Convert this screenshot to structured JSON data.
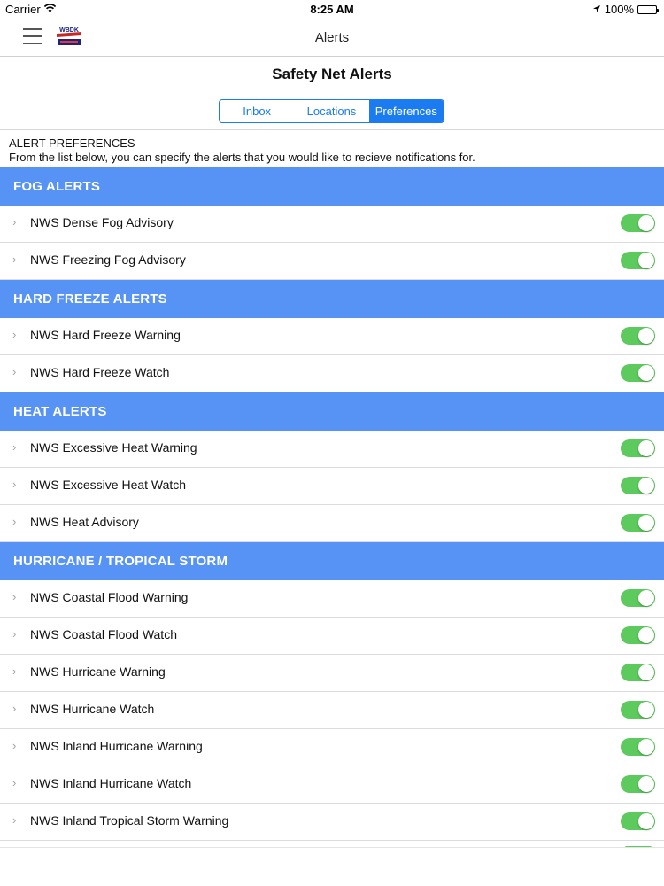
{
  "status_bar": {
    "carrier": "Carrier",
    "time": "8:25 AM",
    "battery": "100%"
  },
  "nav": {
    "title": "Alerts",
    "logo_text": "WBDK"
  },
  "page": {
    "title": "Safety Net Alerts",
    "segments": [
      {
        "label": "Inbox",
        "active": false
      },
      {
        "label": "Locations",
        "active": false
      },
      {
        "label": "Preferences",
        "active": true
      }
    ],
    "prefs_heading": "ALERT PREFERENCES",
    "prefs_description": "From the list below, you can specify the alerts that you would like to recieve notifications for."
  },
  "colors": {
    "accent": "#1b7cf2",
    "section_header": "#5792f5",
    "toggle_on": "#5cca5c"
  },
  "sections": [
    {
      "title": "FOG ALERTS",
      "items": [
        {
          "label": "NWS Dense Fog Advisory",
          "enabled": true
        },
        {
          "label": "NWS Freezing Fog Advisory",
          "enabled": true
        }
      ]
    },
    {
      "title": "HARD FREEZE ALERTS",
      "items": [
        {
          "label": "NWS Hard Freeze Warning",
          "enabled": true
        },
        {
          "label": "NWS Hard Freeze Watch",
          "enabled": true
        }
      ]
    },
    {
      "title": "HEAT ALERTS",
      "items": [
        {
          "label": "NWS Excessive Heat Warning",
          "enabled": true
        },
        {
          "label": "NWS Excessive Heat Watch",
          "enabled": true
        },
        {
          "label": "NWS Heat Advisory",
          "enabled": true
        }
      ]
    },
    {
      "title": "HURRICANE / TROPICAL STORM",
      "items": [
        {
          "label": "NWS Coastal Flood Warning",
          "enabled": true
        },
        {
          "label": "NWS Coastal Flood Watch",
          "enabled": true
        },
        {
          "label": "NWS Hurricane Warning",
          "enabled": true
        },
        {
          "label": "NWS Hurricane Watch",
          "enabled": true
        },
        {
          "label": "NWS Inland Hurricane Warning",
          "enabled": true
        },
        {
          "label": "NWS Inland Hurricane Watch",
          "enabled": true
        },
        {
          "label": "NWS Inland Tropical Storm Warning",
          "enabled": true
        }
      ]
    }
  ]
}
